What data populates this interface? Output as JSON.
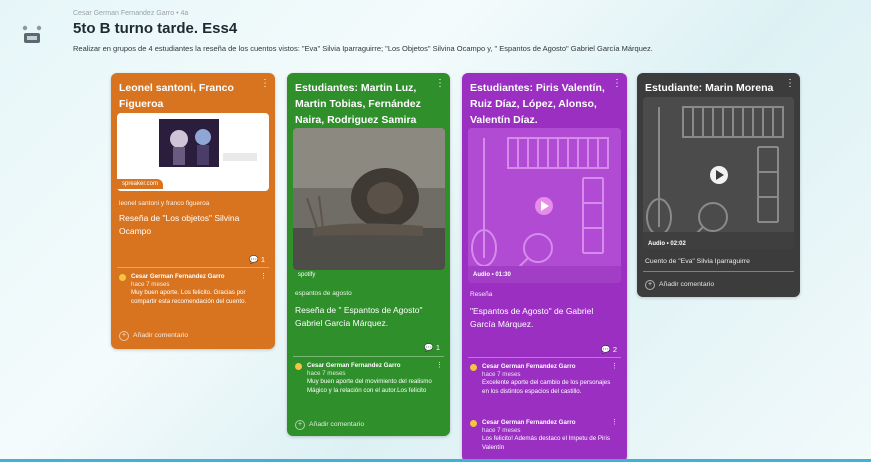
{
  "header": {
    "owner": "Cesar German Fernandez Garro • 4a",
    "title": "5to B turno tarde. Ess4",
    "description": "Realizar en grupos de 4 estudiantes la reseña de los cuentos vistos: \"Eva\" Silvia Iparraguirre; \"Los Objetos\" Silvina Ocampo y, \" Espantos de Agosto\" Gabriel García Márquez."
  },
  "colors": {
    "orange": "#d8741f",
    "green": "#2f8f2b",
    "purple": "#9a2fc2",
    "gray": "#3c3c3c"
  },
  "cards": {
    "orange": {
      "title": "Leonel santoni, Franco Figueroa",
      "tag": "spreaker.com",
      "sub": "leonel santoni y franco figueroa",
      "link_title": "Reseña de \"Los objetos\" Silvina Ocampo",
      "count": "1",
      "comment": {
        "name": "Cesar German Fernandez Garro",
        "time": "hace 7 meses",
        "body": "Muy buen aporte. Los felicito. Gracias por compartir esta recomendación del cuento."
      },
      "add": "Añadir comentario"
    },
    "green": {
      "title": "Estudiantes: Martin Luz, Martin Tobias, Fernández Naira, Rodriguez Samira",
      "tag": "spotify",
      "sub": "espantos de agosto",
      "link_title": "Reseña de \" Espantos de Agosto\" Gabriel García Márquez.",
      "count": "1",
      "comment": {
        "name": "Cesar German Fernandez Garro",
        "time": "hace 7 meses",
        "body": "Muy buen aporte del movimiento del realismo Mágico y la relación con el autor.Los felicito"
      },
      "add": "Añadir comentario"
    },
    "purple": {
      "title": "Estudiantes: Piris Valentín, Ruiz Díaz, López, Alonso, Valentín Díaz.",
      "audio": "Audio • 01:30",
      "sub": "Reseña",
      "link_title": "\"Espantos de Agosto\" de Gabriel García Márquez.",
      "count": "2",
      "comment1": {
        "name": "Cesar German Fernandez Garro",
        "time": "hace 7 meses",
        "body": "Excelente aporte del cambio de los personajes en los distintos espacios del castillo."
      },
      "comment2": {
        "name": "Cesar German Fernandez Garro",
        "time": "hace 7 meses",
        "body": "Los felicito! Además destaco el Impetu de Piris Valentín"
      }
    },
    "gray": {
      "title": "Estudiante: Marin Morena",
      "audio": "Audio • 02:02",
      "link_title": "Cuento de \"Eva\" Silvia Iparraguirre",
      "add": "Añadir comentario"
    }
  }
}
